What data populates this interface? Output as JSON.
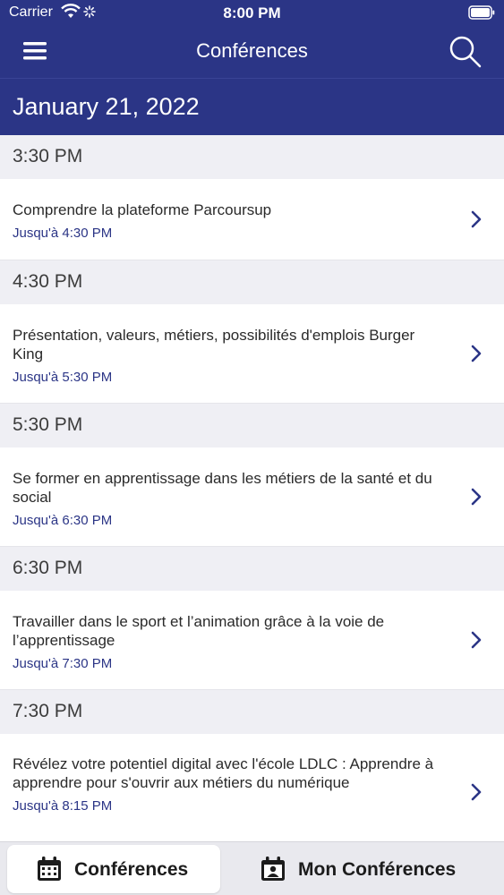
{
  "status_bar": {
    "carrier": "Carrier",
    "time": "8:00 PM"
  },
  "nav": {
    "title": "Conférences",
    "menu_icon": "hamburger-menu",
    "search_icon": "search"
  },
  "date_header": "January 21, 2022",
  "colors": {
    "accent": "#2b3586",
    "section_bg": "#efeff4"
  },
  "sections": [
    {
      "time": "3:30 PM",
      "title": "Comprendre la plateforme Parcoursup",
      "until": "Jusqu'à 4:30 PM"
    },
    {
      "time": "4:30 PM",
      "title": "Présentation, valeurs, métiers, possibilités d'emplois Burger King",
      "until": "Jusqu'à 5:30 PM"
    },
    {
      "time": "5:30 PM",
      "title": "Se former en apprentissage dans les métiers de la santé et du social",
      "until": "Jusqu'à 6:30 PM"
    },
    {
      "time": "6:30 PM",
      "title": "Travailler dans le sport et l’animation grâce à la voie de l’apprentissage",
      "until": "Jusqu'à 7:30 PM"
    },
    {
      "time": "7:30 PM",
      "title": "Révélez votre potentiel digital avec l'école LDLC : Apprendre à apprendre pour s'ouvrir aux métiers du numérique",
      "until": "Jusqu'à 8:15 PM"
    }
  ],
  "tabs": [
    {
      "label": "Conférences",
      "icon": "calendar-icon",
      "active": true
    },
    {
      "label": "Mon Conférences",
      "icon": "person-calendar-icon",
      "active": false
    }
  ]
}
